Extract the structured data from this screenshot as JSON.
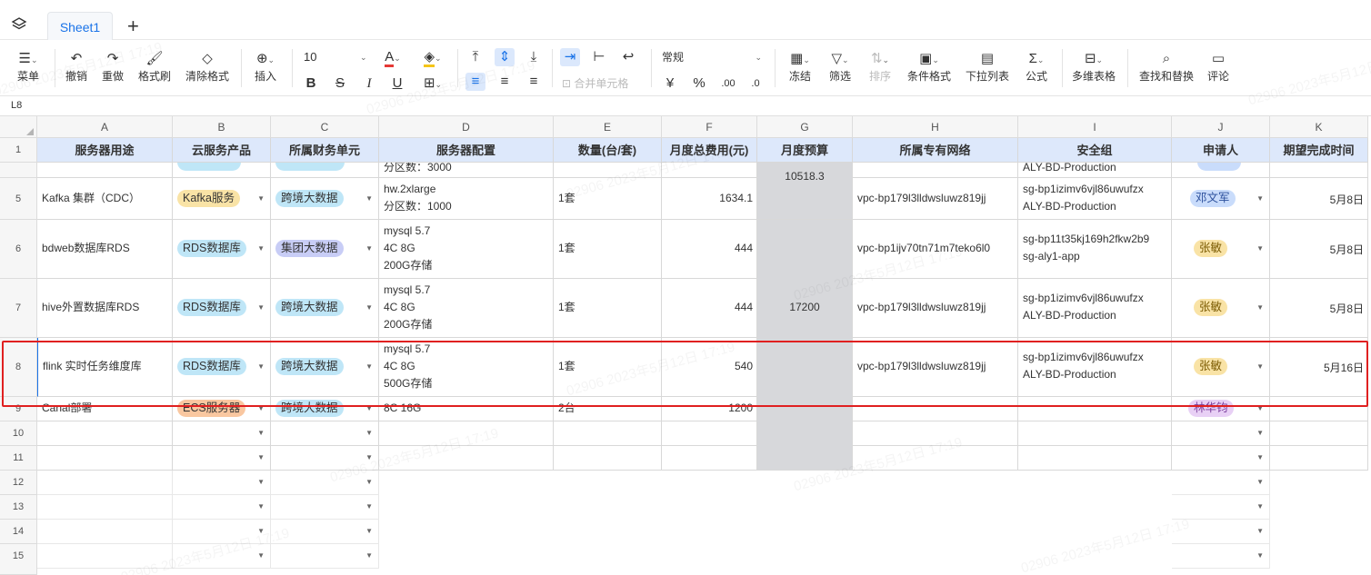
{
  "sheet_tab": "Sheet1",
  "cell_ref": "L8",
  "toolbar": {
    "menu": "菜单",
    "undo": "撤销",
    "redo": "重做",
    "format_painter": "格式刷",
    "clear_format": "清除格式",
    "insert": "插入",
    "font_size": "10",
    "merge": "合并单元格",
    "number_format": "常规",
    "currency": "¥",
    "percent": "%",
    "freeze": "冻结",
    "filter": "筛选",
    "sort": "排序",
    "conditional": "条件格式",
    "dropdown": "下拉列表",
    "formula": "公式",
    "multi_table": "多维表格",
    "find_replace": "查找和替换",
    "comment": "评论"
  },
  "columns": [
    "A",
    "B",
    "C",
    "D",
    "E",
    "F",
    "G",
    "H",
    "I",
    "J",
    "K"
  ],
  "headers": [
    "服务器用途",
    "云服务产品",
    "所属财务单元",
    "服务器配置",
    "数量(台/套)",
    "月度总费用(元)",
    "月度预算",
    "所属专有网络",
    "安全组",
    "申请人",
    "期望完成时间"
  ],
  "row_numbers": [
    "1",
    "5",
    "6",
    "7",
    "8",
    "9",
    "10",
    "11",
    "12",
    "13",
    "14",
    "15"
  ],
  "partial_row": {
    "config": "分区数：3000",
    "security": "ALY-BD-Production",
    "budget": "10518.3"
  },
  "rows": [
    {
      "a": "Kafka 集群（CDC）",
      "b": "Kafka服务",
      "c": "跨境大数据",
      "d1": "hw.2xlarge",
      "d2": "分区数：1000",
      "d3": "",
      "e": "1套",
      "f": "1634.1",
      "h": "vpc-bp179l3lldwsluwz819jj",
      "i1": "sg-bp1izimv6vjl86uwufzx",
      "i2": "ALY-BD-Production",
      "j": "邓文军",
      "k": "5月8日"
    },
    {
      "a": "bdweb数据库RDS",
      "b": "RDS数据库",
      "c": "集团大数据",
      "d1": "mysql 5.7",
      "d2": "4C 8G",
      "d3": "200G存储",
      "e": "1套",
      "f": "444",
      "h": "vpc-bp1ijv70tn71m7teko6l0",
      "i1": "sg-bp11t35kj169h2fkw2b9",
      "i2": "sg-aly1-app",
      "j": "张敏",
      "k": "5月8日"
    },
    {
      "a": "hive外置数据库RDS",
      "b": "RDS数据库",
      "c": "跨境大数据",
      "d1": "mysql 5.7",
      "d2": "4C 8G",
      "d3": "200G存储",
      "e": "1套",
      "f": "444",
      "h": "vpc-bp179l3lldwsluwz819jj",
      "i1": "sg-bp1izimv6vjl86uwufzx",
      "i2": "ALY-BD-Production",
      "j": "张敏",
      "k": "5月8日"
    },
    {
      "a": "flink 实时任务维度库",
      "b": "RDS数据库",
      "c": "跨境大数据",
      "d1": "mysql 5.7",
      "d2": "4C 8G",
      "d3": "500G存储",
      "e": "1套",
      "f": "540",
      "h": "vpc-bp179l3lldwsluwz819jj",
      "i1": "sg-bp1izimv6vjl86uwufzx",
      "i2": "ALY-BD-Production",
      "j": "张敏",
      "k": "5月16日"
    },
    {
      "a": "Canal部署",
      "b": "ECS服务器",
      "c": "跨境大数据",
      "d1": "8C 16G",
      "d2": "",
      "d3": "",
      "e": "2台",
      "f": "1200",
      "h": "",
      "i1": "",
      "i2": "",
      "j": "林华钧",
      "k": ""
    }
  ],
  "budget_merged": "17200",
  "watermark": "02906 2023年5月12日 17:19",
  "colors": {
    "kafka_tag": "#f9e3a6",
    "rds_tag": "#bfe6f7",
    "crossborder_tag": "#bfe6f7",
    "group_tag": "#c8cdf6",
    "ecs_tag": "#f9c7a0",
    "zhangmin_tag": "#f9e3a6",
    "dengwenjun_tag": "#c9dcfb",
    "lin_tag": "#e8d0f5",
    "header_bg": "#dde8fb",
    "budget_col": "#d7d8db",
    "highlight": "#e02020"
  }
}
